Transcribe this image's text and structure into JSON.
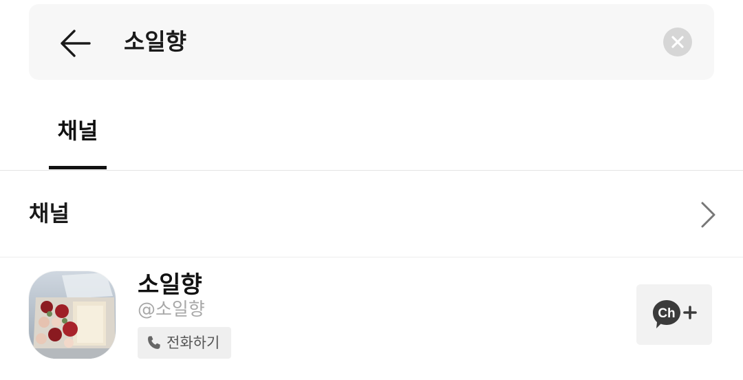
{
  "search": {
    "query": "소일향",
    "back_icon": "arrow-left-icon",
    "clear_icon": "clear-circle-icon"
  },
  "tabs": [
    {
      "label": "채널",
      "active": true
    }
  ],
  "section": {
    "title": "채널",
    "chevron_icon": "chevron-right-icon"
  },
  "channel": {
    "name": "소일향",
    "handle": "@소일향",
    "avatar_icon": "channel-profile-image",
    "call_label": "전화하기",
    "call_icon": "phone-icon",
    "add_icon": "channel-add-icon",
    "add_badge": "Ch"
  },
  "colors": {
    "search_bg": "#f7f7f7",
    "clear_bg": "#d6d6d6",
    "active_tab": "#111111",
    "handle_text": "#a8a8a8",
    "button_bg": "#f2f2f2",
    "ch_badge": "#3b3b3b"
  }
}
